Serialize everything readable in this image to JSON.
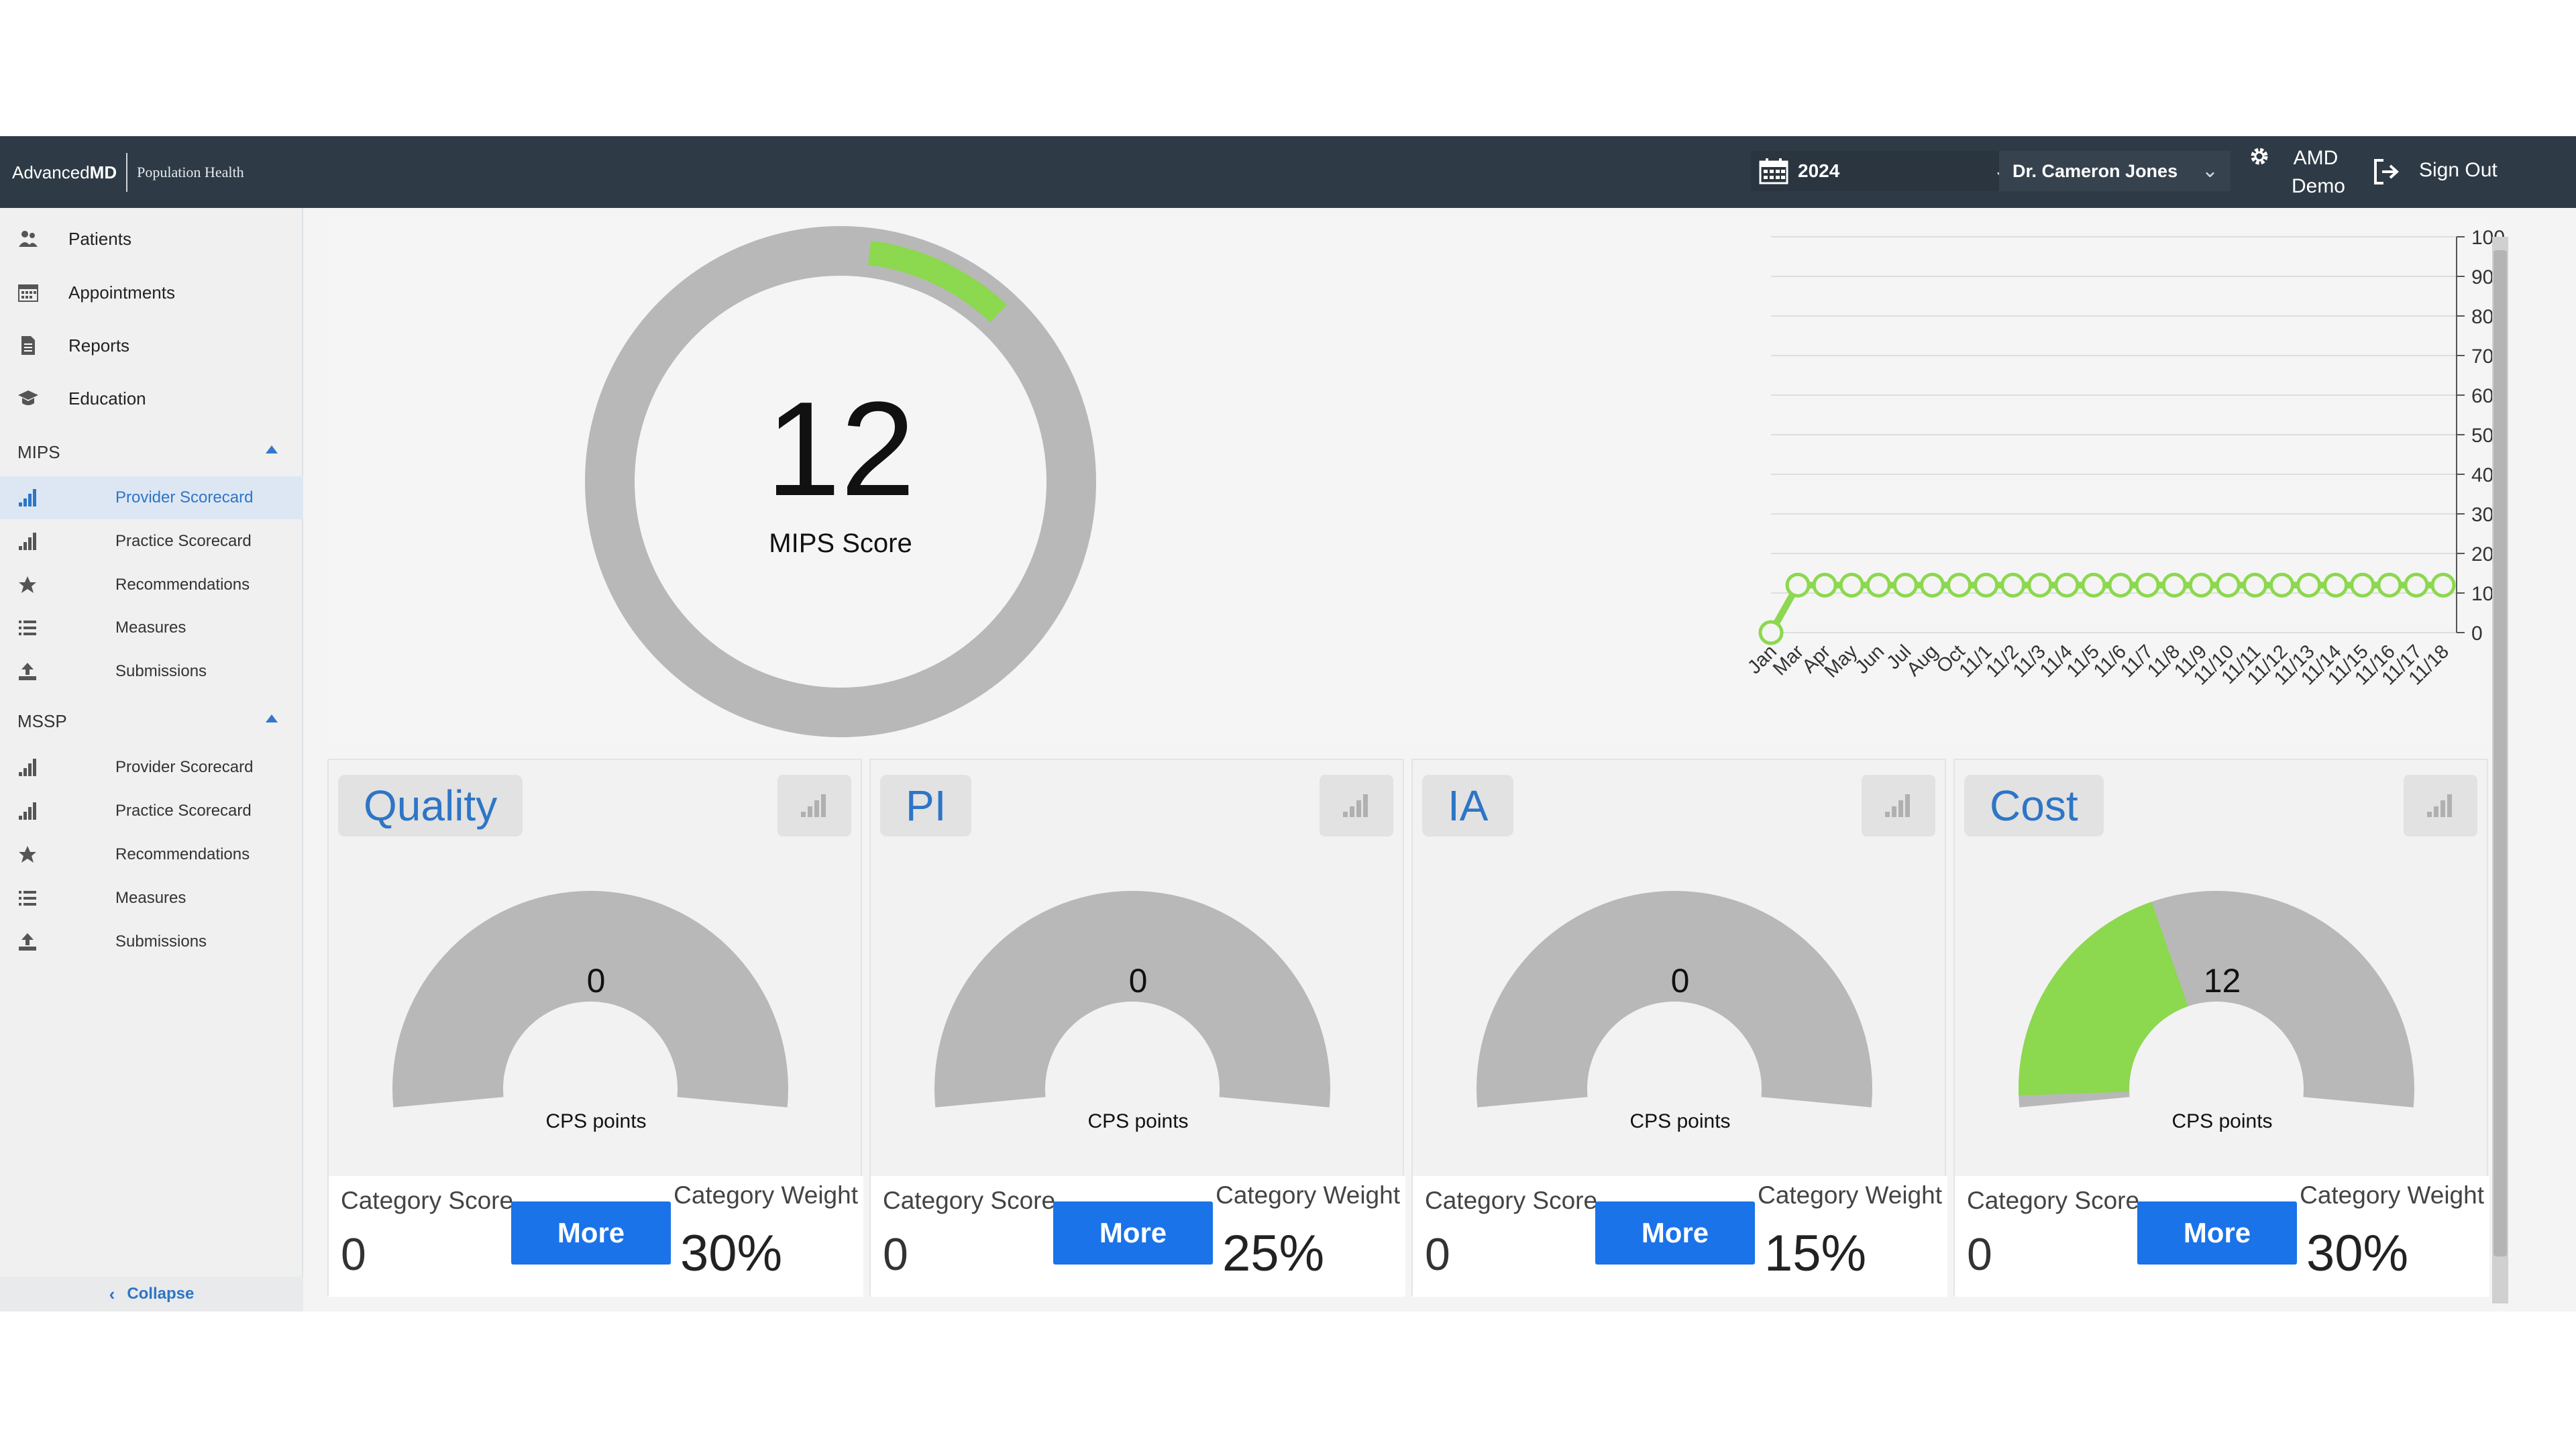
{
  "header": {
    "brand_main": "Advanced",
    "brand_bold": "MD",
    "brand_sub": "Population Health",
    "year": "2024",
    "provider": "Dr. Cameron Jones",
    "user_line1": "AMD",
    "user_line2": "Demo",
    "signout": "Sign Out"
  },
  "sidebar": {
    "items": [
      {
        "label": "Patients",
        "icon": "patients-icon"
      },
      {
        "label": "Appointments",
        "icon": "calendar-icon"
      },
      {
        "label": "Reports",
        "icon": "document-icon"
      },
      {
        "label": "Education",
        "icon": "graduation-cap-icon"
      }
    ],
    "mips": {
      "label": "MIPS",
      "items": [
        {
          "label": "Provider Scorecard",
          "icon": "bar-chart-icon",
          "active": true
        },
        {
          "label": "Practice Scorecard",
          "icon": "bar-chart-icon"
        },
        {
          "label": "Recommendations",
          "icon": "star-icon"
        },
        {
          "label": "Measures",
          "icon": "list-icon"
        },
        {
          "label": "Submissions",
          "icon": "upload-icon"
        }
      ]
    },
    "mssp": {
      "label": "MSSP",
      "items": [
        {
          "label": "Provider Scorecard",
          "icon": "bar-chart-icon"
        },
        {
          "label": "Practice Scorecard",
          "icon": "bar-chart-icon"
        },
        {
          "label": "Recommendations",
          "icon": "star-icon"
        },
        {
          "label": "Measures",
          "icon": "list-icon"
        },
        {
          "label": "Submissions",
          "icon": "upload-icon"
        }
      ]
    },
    "collapse": "Collapse"
  },
  "score": {
    "value": "12",
    "label": "MIPS Score",
    "fraction": 0.12
  },
  "chart_data": {
    "type": "line",
    "x": [
      "Jan",
      "Mar",
      "Apr",
      "May",
      "Jun",
      "Jul",
      "Aug",
      "Oct",
      "11/1",
      "11/2",
      "11/3",
      "11/4",
      "11/5",
      "11/6",
      "11/7",
      "11/8",
      "11/9",
      "11/10",
      "11/11",
      "11/12",
      "11/13",
      "11/14",
      "11/15",
      "11/16",
      "11/17",
      "11/18"
    ],
    "series": [
      {
        "values": [
          0,
          12,
          12,
          12,
          12,
          12,
          12,
          12,
          12,
          12,
          12,
          12,
          12,
          12,
          12,
          12,
          12,
          12,
          12,
          12,
          12,
          12,
          12,
          12,
          12,
          12
        ]
      }
    ],
    "y_ticks": [
      0,
      10,
      20,
      30,
      40,
      50,
      60,
      70,
      80,
      90,
      100
    ],
    "ylim": [
      0,
      100
    ],
    "color": "#8cd84e",
    "grid": true
  },
  "labels": {
    "cps": "CPS points",
    "category_score": "Category Score",
    "category_weight": "Category Weight",
    "more": "More"
  },
  "cards": [
    {
      "title": "Quality",
      "points": "0",
      "points_fraction": 0,
      "score": "0",
      "weight": "30%"
    },
    {
      "title": "PI",
      "points": "0",
      "points_fraction": 0,
      "score": "0",
      "weight": "25%"
    },
    {
      "title": "IA",
      "points": "0",
      "points_fraction": 0,
      "score": "0",
      "weight": "15%"
    },
    {
      "title": "Cost",
      "points": "12",
      "points_fraction": 0.4,
      "score": "0",
      "weight": "30%"
    }
  ],
  "colors": {
    "accent": "#2e75c6",
    "button": "#1a73e8",
    "progress": "#8cd84e",
    "gauge_track": "#b8b8b8",
    "header_bg": "#2e3a45"
  }
}
